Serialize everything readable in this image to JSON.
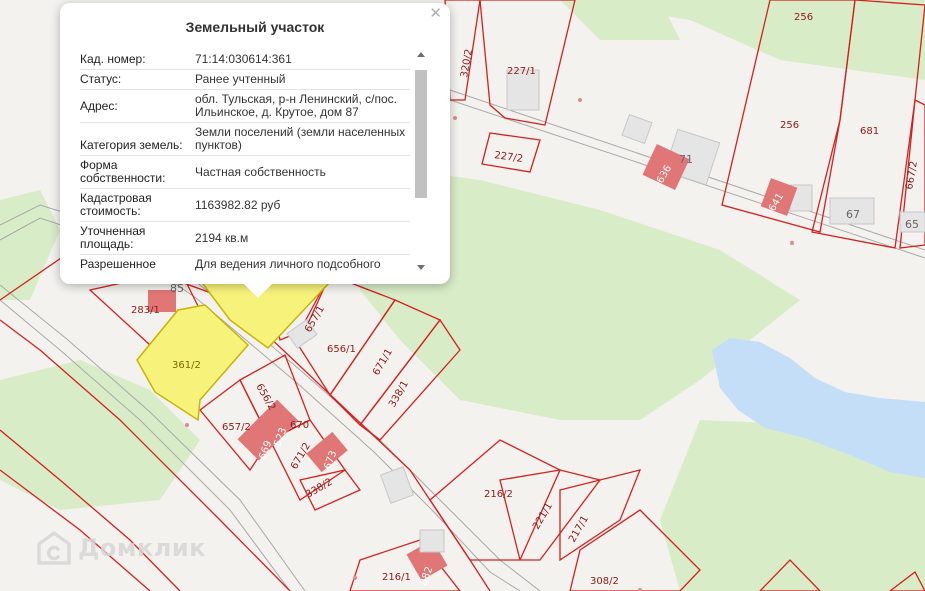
{
  "popup": {
    "title": "Земельный участок",
    "close_icon": "✕",
    "rows": [
      {
        "label": "Кад. номер:",
        "value": "71:14:030614:361"
      },
      {
        "label": "Статус:",
        "value": "Ранее учтенный"
      },
      {
        "label": "Адрес:",
        "value": "обл. Тульская, р-н Ленинский, с/пос. Ильинское, д. Крутое, дом 87"
      },
      {
        "label": "Категория земель:",
        "value": "Земли поселений (земли населенных пунктов)"
      },
      {
        "label": "Форма собственности:",
        "value": "Частная собственность"
      },
      {
        "label": "Кадастровая стоимость:",
        "value": "1163982.82 руб"
      },
      {
        "label": "Уточненная площадь:",
        "value": "2194 кв.м"
      },
      {
        "label": "Разрешенное",
        "value": "Для ведения личного подсобного"
      }
    ]
  },
  "map": {
    "colors": {
      "plot_border": "#d42020",
      "selected_fill": "#f7f27a",
      "building": "#e07676",
      "water": "#c5def7",
      "greenery": "#d8ecc8"
    },
    "plot_labels": [
      "320/2",
      "227/1",
      "227/2",
      "256",
      "256",
      "681",
      "667/2",
      "283/1",
      "361/2",
      "657/1",
      "656/1",
      "671/1",
      "338/1",
      "656/2",
      "657/2",
      "669",
      "523",
      "670",
      "671/2",
      "673",
      "338/2",
      "216/2",
      "221/1",
      "217/1",
      "308/2",
      "216/1"
    ],
    "building_labels": [
      "636",
      "641",
      "882"
    ],
    "gray_labels": [
      "71",
      "67",
      "65",
      "85"
    ]
  },
  "watermark": {
    "text": "Домклик"
  }
}
